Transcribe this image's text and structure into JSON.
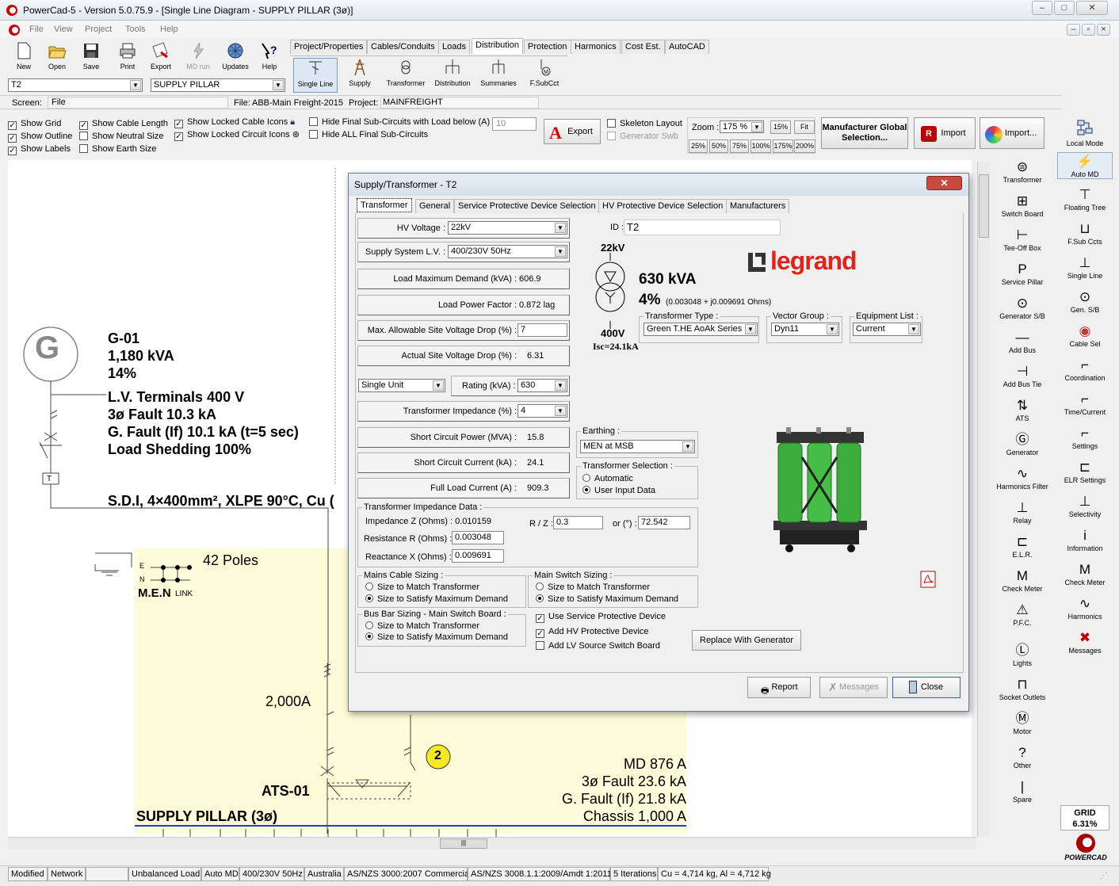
{
  "window": {
    "title": "PowerCad-5 - Version 5.0.75.9 - [Single Line Diagram - SUPPLY PILLAR (3ø)]",
    "min": "–",
    "max": "□",
    "close": "✕"
  },
  "menu": [
    "File",
    "View",
    "Project",
    "Tools",
    "Help"
  ],
  "toolbar": [
    {
      "label": "New",
      "icon": "new-icon"
    },
    {
      "label": "Open",
      "icon": "open-icon"
    },
    {
      "label": "Save",
      "icon": "save-icon"
    },
    {
      "label": "Print",
      "icon": "print-icon"
    },
    {
      "label": "Export",
      "icon": "export-icon"
    },
    {
      "label": "MD run",
      "icon": "md-run-icon"
    },
    {
      "label": "Updates",
      "icon": "updates-icon"
    },
    {
      "label": "Help",
      "icon": "help-icon"
    }
  ],
  "tabs": [
    "Project/Properties",
    "Cables/Conduits",
    "Loads",
    "Distribution",
    "Protection",
    "Harmonics",
    "Cost Est.",
    "AutoCAD"
  ],
  "active_tab": "Distribution",
  "dist_tools": [
    "Single Line",
    "Supply",
    "Transformer",
    "Distribution",
    "Summaries",
    "F.SubCct"
  ],
  "selectors": {
    "left": "T2",
    "right": "SUPPLY PILLAR"
  },
  "screen": {
    "label": "Screen:",
    "value": "File",
    "file_label": "File:",
    "file_value": "ABB-Main Freight-2015",
    "project_label": "Project:",
    "project_value": "MAINFREIGHT"
  },
  "options": {
    "col1": [
      {
        "label": "Show Grid",
        "checked": true
      },
      {
        "label": "Show Outline",
        "checked": true
      },
      {
        "label": "Show Labels",
        "checked": true
      }
    ],
    "col2": [
      {
        "label": "Show Cable Length",
        "checked": true
      },
      {
        "label": "Show Neutral Size",
        "checked": false
      },
      {
        "label": "Show Earth Size",
        "checked": false
      }
    ],
    "col3": [
      {
        "label": "Show Locked Cable Icons",
        "checked": true
      },
      {
        "label": "Show Locked Circuit Icons",
        "checked": true
      }
    ],
    "col4": [
      {
        "label": "Hide Final Sub-Circuits with Load below (A)",
        "checked": false
      },
      {
        "label": "Hide ALL Final Sub-Circuits",
        "checked": false
      }
    ],
    "load_below_value": "10",
    "export_label": "Export",
    "skeleton": {
      "label": "Skeleton Layout",
      "checked": false
    },
    "gen_swb": {
      "label": "Generator Swb",
      "checked": false
    },
    "zoom_label": "Zoom :",
    "zoom_value": "175 %",
    "zoom_15": "15%",
    "zoom_fit": "Fit",
    "zoom_presets": [
      "25%",
      "50%",
      "75%",
      "100%",
      "175%",
      "200%"
    ],
    "mfr_btn": "Manufacturer Global Selection...",
    "import1": "Import",
    "import2": "Import...",
    "local_mode": "Local Mode"
  },
  "diagram": {
    "gen_id": "G-01",
    "gen_kva": "1,180 kVA",
    "gen_pct": "14%",
    "lv_terminals": "L.V. Terminals 400 V",
    "fault": "3ø Fault 10.3 kA",
    "gfault": "G. Fault (If) 10.1 kA (t=5 sec)",
    "shedding": "Load Shedding 100%",
    "cable": "S.D.I, 4×400mm², XLPE 90°C, Cu (",
    "poles": "42 Poles",
    "men": "M.E.N",
    "link": "LINK",
    "earth_e": "E",
    "earth_n": "N",
    "t_box": "T",
    "breaker": "2,000A",
    "ats": "ATS-01",
    "circle": "2",
    "md": "MD 876 A",
    "fault2": "3ø Fault 23.6 kA",
    "gfault2": "G. Fault (If) 21.8 kA",
    "chassis": "Chassis 1,000 A",
    "board": "SUPPLY PILLAR (3ø)",
    "gen_symbol": "G"
  },
  "dialog": {
    "title": "Supply/Transformer - T2",
    "tabs": [
      "Transformer",
      "General",
      "Service Protective Device Selection",
      "HV Protective Device Selection",
      "Manufacturers"
    ],
    "hv_voltage_label": "HV Voltage :",
    "hv_voltage": "22kV",
    "supply_lv_label": "Supply System L.V. :",
    "supply_lv": "400/230V 50Hz",
    "load_md_label": "Load Maximum Demand (kVA) :",
    "load_md": "606.9",
    "pf_label": "Load Power Factor :",
    "pf": "0.872 lag",
    "max_vd_label": "Max. Allowable Site Voltage Drop (%) :",
    "max_vd": "7",
    "act_vd_label": "Actual Site Voltage Drop (%) :",
    "act_vd": "6.31",
    "unit": "Single Unit",
    "rating_label": "Rating (kVA) :",
    "rating": "630",
    "imp_label": "Transformer Impedance (%) :",
    "imp": "4",
    "scp_label": "Short Circuit Power (MVA) :",
    "scp": "15.8",
    "scc_label": "Short Circuit Current (kA) :",
    "scc": "24.1",
    "flc_label": "Full Load Current (A) :",
    "flc": "909.3",
    "id_label": "ID :",
    "id": "T2",
    "tx_hv": "22kV",
    "tx_lv": "400V",
    "tx_isc": "Isc=24.1kA",
    "tx_kva": "630 kVA",
    "tx_pct": "4%",
    "tx_ohms": "(0.003048 + j0.009691 Ohms)",
    "brand": "legrand",
    "type_label": "Transformer Type :",
    "type": "Green T.HE AoAk Series",
    "vg_label": "Vector Group :",
    "vg": "Dyn11",
    "eq_label": "Equipment List :",
    "eq": "Current",
    "earthing_label": "Earthing :",
    "earthing": "MEN at MSB",
    "txsel_label": "Transformer Selection :",
    "txsel_auto": "Automatic",
    "txsel_user": "User Input Data",
    "txsel_value": "User Input Data",
    "impdata_label": "Transformer Impedance Data :",
    "z_label": "Impedance Z (Ohms) :",
    "z": "0.010159",
    "rz_label": "R / Z :",
    "rz": "0.3",
    "deg_label": "or (°) :",
    "deg": "72.542",
    "r_label": "Resistance R (Ohms) :",
    "r": "0.003048",
    "x_label": "Reactance X (Ohms) :",
    "x": "0.009691",
    "mains_label": "Mains Cable Sizing :",
    "switch_label": "Main Switch Sizing :",
    "busbar_label": "Bus Bar Sizing - Main Switch Board :",
    "opt_match": "Size to Match Transformer",
    "opt_md": "Size to Satisfy Maximum Demand",
    "mains_value": "Size to Satisfy Maximum Demand",
    "switch_value": "Size to Satisfy Maximum Demand",
    "busbar_value": "Size to Satisfy Maximum Demand",
    "use_spd": {
      "label": "Use Service Protective Device",
      "checked": true
    },
    "add_hv": {
      "label": "Add HV Protective Device",
      "checked": true
    },
    "add_lv": {
      "label": "Add LV Source Switch Board",
      "checked": false
    },
    "replace": "Replace With Generator",
    "report": "Report",
    "messages": "Messages",
    "close": "Close"
  },
  "right_col1": [
    "Transformer",
    "Switch Board",
    "Tee-Off Box",
    "Service Pillar",
    "Generator S/B",
    "Add Bus",
    "Add Bus Tie",
    "ATS",
    "Generator",
    "Harmonics Filter",
    "Relay",
    "E.L.R.",
    "Check Meter",
    "P.F.C.",
    "Lights",
    "Socket Outlets",
    "Motor",
    "Other",
    "Spare"
  ],
  "right_col2": [
    "Auto MD",
    "Floating Tree",
    "F.Sub Ccts",
    "Single Line",
    "Gen. S/B",
    "Cable Sel",
    "Coordination",
    "Time/Current",
    "Settings",
    "ELR Settings",
    "Selectivity",
    "Information",
    "Check Meter",
    "Harmonics",
    "Messages"
  ],
  "grid": {
    "label": "GRID",
    "value": "6.31%"
  },
  "logo": "POWERCAD",
  "status": [
    "Modified",
    "Network",
    "",
    "Unbalanced Load",
    "Auto MD",
    "400/230V 50Hz",
    "Australia",
    "AS/NZS 3000:2007 Commercial",
    "AS/NZS 3008.1.1:2009/Amdt 1:2011",
    "5 Iterations",
    "Cu = 4,714 kg, Al = 4,712 kg"
  ],
  "scroll_thumb": "|||",
  "colors": {
    "accent": "#cc0000",
    "board": "#fdfbd8",
    "bus": "#1c3fd0",
    "circle": "#f6e823",
    "legrand": "#e2231a",
    "green": "#3cae3c"
  }
}
